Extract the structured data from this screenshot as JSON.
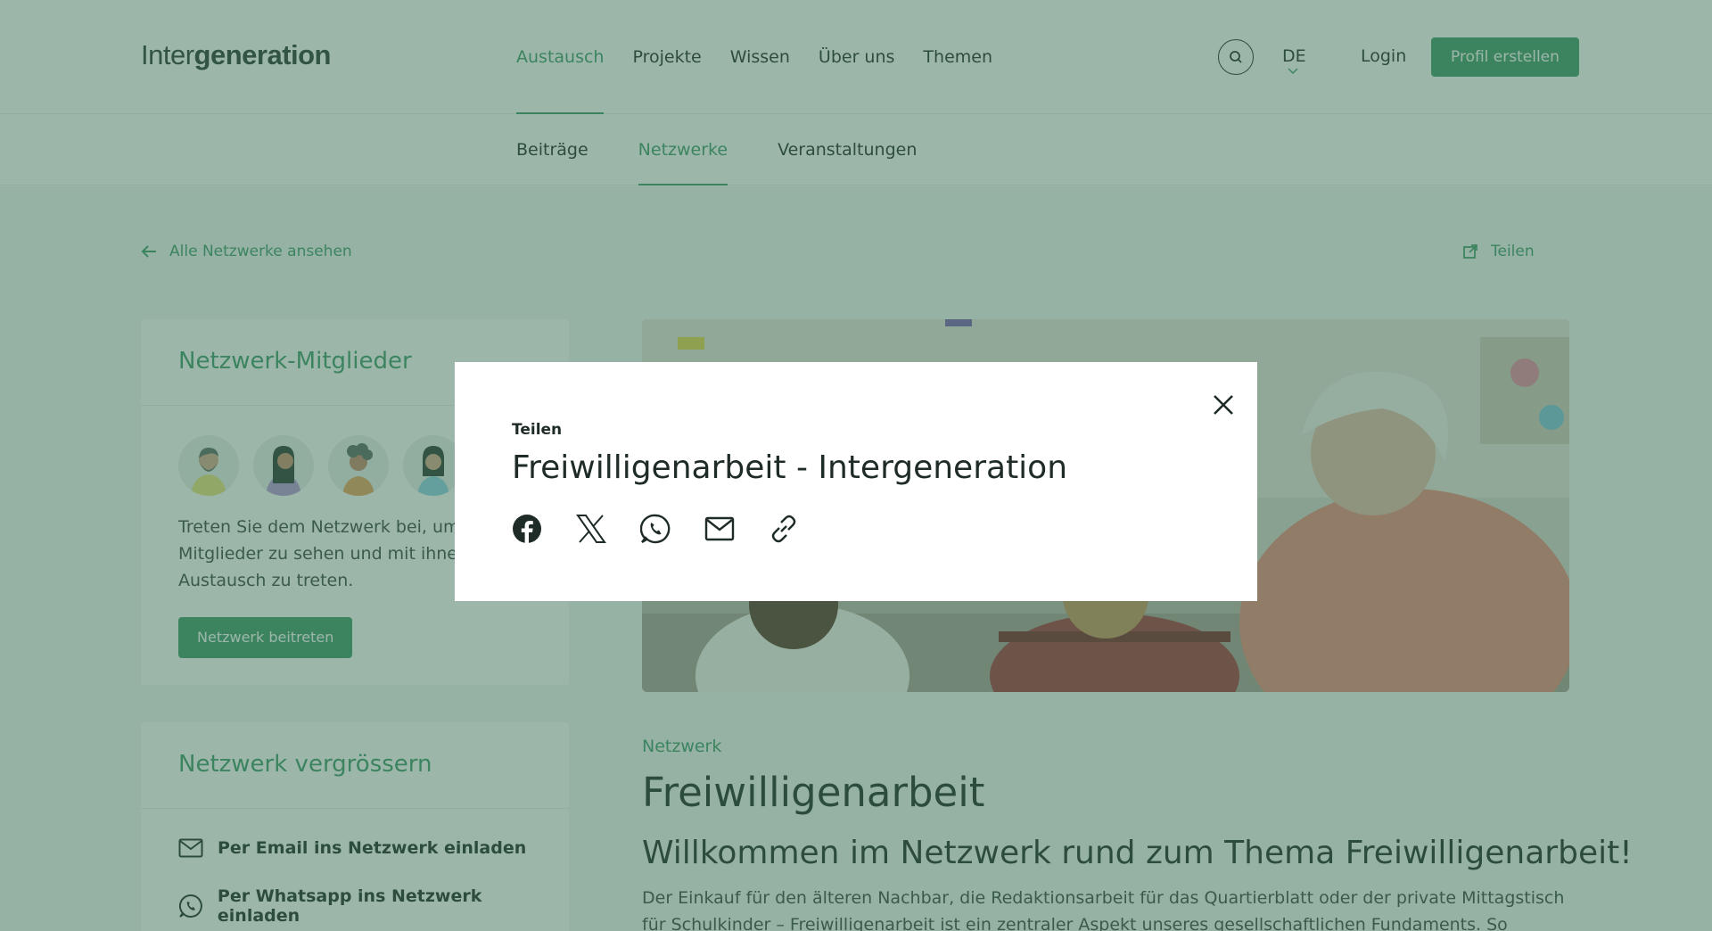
{
  "header": {
    "logo_light": "Inter",
    "logo_bold": "generation",
    "nav": [
      {
        "label": "Austausch"
      },
      {
        "label": "Projekte"
      },
      {
        "label": "Wissen"
      },
      {
        "label": "Über uns"
      },
      {
        "label": "Themen"
      }
    ],
    "language": "DE",
    "login_label": "Login",
    "profile_button": "Profil erstellen"
  },
  "subnav": {
    "items": [
      {
        "label": "Beiträge"
      },
      {
        "label": "Netzwerke"
      },
      {
        "label": "Veranstaltungen"
      }
    ]
  },
  "page": {
    "back_link": "Alle Netzwerke ansehen",
    "share_link": "Teilen",
    "members_card": {
      "title": "Netzwerk-Mitglieder",
      "text": "Treten Sie dem Netzwerk bei, um die Mitglieder zu sehen und mit ihnen in Austausch zu treten.",
      "join_button": "Netzwerk beitreten"
    },
    "grow_card": {
      "title": "Netzwerk vergrössern",
      "invite_email": "Per Email ins Netzwerk einladen",
      "invite_whatsapp": "Per Whatsapp ins Netzwerk einladen"
    },
    "category_label": "Netzwerk",
    "title": "Freiwilligenarbeit",
    "subtitle": "Willkommen im Netzwerk rund zum Thema Freiwilligenarbeit!",
    "paragraph": "Der Einkauf für den älteren Nachbar, die Redaktionsarbeit für das Quartierblatt oder der private Mittagstisch für Schulkinder – Freiwilligenarbeit ist ein zentraler Aspekt unseres gesellschaftlichen Fundaments. So engagieren sich etwa vier"
  },
  "modal": {
    "eyebrow": "Teilen",
    "title": "Freiwilligenarbeit - Intergeneration",
    "share_options": [
      "facebook-icon",
      "x-icon",
      "whatsapp-icon",
      "mail-icon",
      "link-icon"
    ]
  },
  "colors": {
    "brand_green": "#3f9b68",
    "overlay": "rgba(58,110,86,0.5)"
  }
}
